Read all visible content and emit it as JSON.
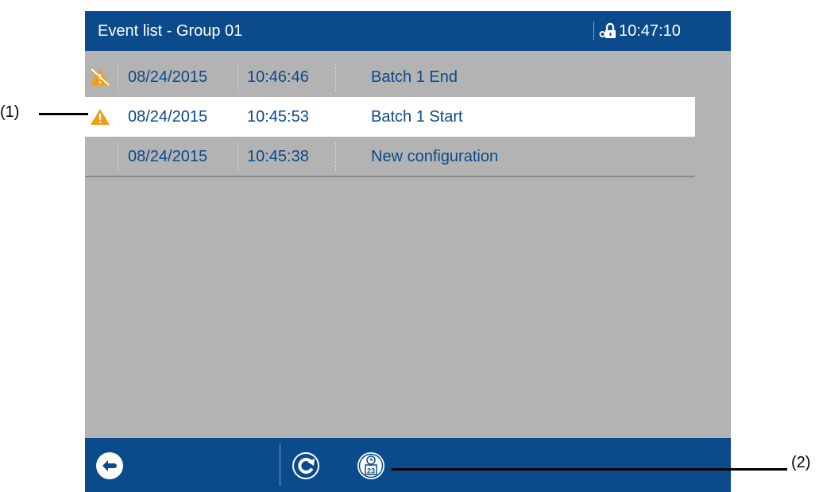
{
  "header": {
    "title": "Event list - Group 01",
    "time": "10:47:10",
    "lock_icon": "lock-key-icon"
  },
  "colors": {
    "bar": "#0b4a8b",
    "background": "#b3b3b3",
    "text": "#0b4a8b",
    "selected_row": "#ffffff",
    "warning_orange": "#f39c12"
  },
  "events": [
    {
      "date": "08/24/2015",
      "time": "10:46:46",
      "text": "Batch 1 End",
      "icon": "warning-crossed-icon",
      "selected": false
    },
    {
      "date": "08/24/2015",
      "time": "10:45:53",
      "text": "Batch 1 Start",
      "icon": "warning-icon",
      "selected": true
    },
    {
      "date": "08/24/2015",
      "time": "10:45:38",
      "text": "New configuration",
      "icon": "",
      "selected": false
    }
  ],
  "toolbar": {
    "back_icon": "back-arrow-icon",
    "refresh_icon": "refresh-icon",
    "datetime_icon": "clock-calendar-icon",
    "calendar_day": "23"
  },
  "callouts": {
    "c1": "(1)",
    "c2": "(2)"
  }
}
